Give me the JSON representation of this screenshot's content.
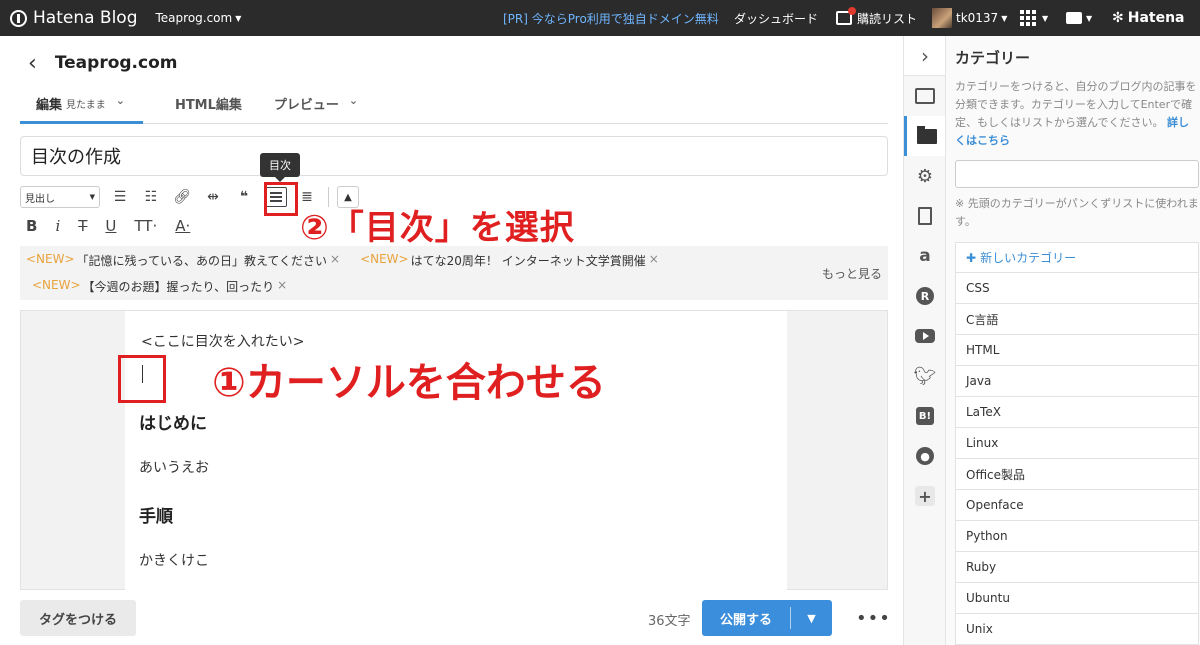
{
  "topbar": {
    "logo": "Hatena Blog",
    "blog_switch": "Teaprog.com",
    "pr": "[PR] 今ならPro利用で独自ドメイン無料",
    "dashboard": "ダッシュボード",
    "reader": "購読リスト",
    "user": "tk0137",
    "hatena": "Hatena"
  },
  "header": {
    "blog_title": "Teaprog.com"
  },
  "tabs": {
    "edit": "編集",
    "edit_mode": "見たまま",
    "html": "HTML編集",
    "preview": "プレビュー"
  },
  "title_value": "目次の作成",
  "toolbar": {
    "heading_select": "見出し",
    "tooltip": "目次"
  },
  "notice": {
    "new_tag": "<NEW>",
    "item1": "「記憶に残っている、あの日」教えてください",
    "item2": "はてな20周年！ インターネット文学賞開催",
    "item3": "【今週のお題】握ったり、回ったり",
    "more": "もっと見る"
  },
  "editor": {
    "placeholder_line": "<ここに目次を入れたい>",
    "heading1": "はじめに",
    "para1": "あいうえお",
    "heading2": "手順",
    "para2": "かきくけこ"
  },
  "annotations": {
    "step1": "①カーソルを合わせる",
    "step2": "②「目次」を選択",
    "color": "#e02020"
  },
  "bottom": {
    "tag_button": "タグをつける",
    "char_count": "36文字",
    "publish": "公開する"
  },
  "panel": {
    "title": "カテゴリー",
    "desc": "カテゴリーをつけると、自分のブログ内の記事を分類できます。カテゴリーを入力してEnterで確定、もしくはリストから選んでください。",
    "desc_link": "詳しくはこちら",
    "note": "※ 先頭のカテゴリーがパンくずリストに使われます。",
    "new_category": "新しいカテゴリー",
    "categories": [
      "CSS",
      "C言語",
      "HTML",
      "Java",
      "LaTeX",
      "Linux",
      "Office製品",
      "Openface",
      "Python",
      "Ruby",
      "Ubuntu",
      "Unix"
    ]
  },
  "colors": {
    "accent": "#3b8edb",
    "topbar": "#2b2b2b",
    "new_tag": "#e8a33d"
  }
}
